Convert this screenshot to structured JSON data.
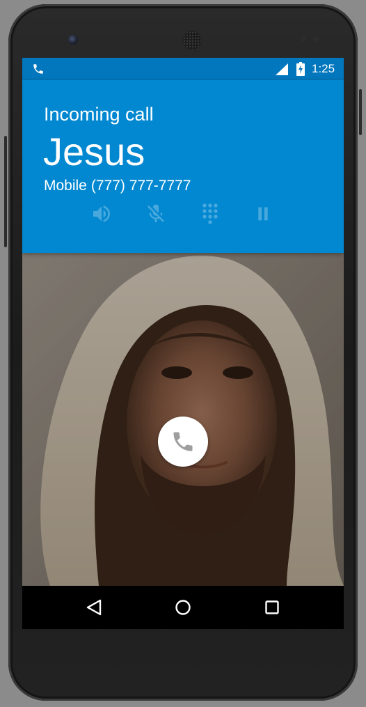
{
  "status_bar": {
    "time": "1:25",
    "icons": [
      "phone-icon",
      "signal-icon",
      "battery-charging-icon"
    ],
    "color": "#0277bd"
  },
  "call": {
    "state": "Incoming call",
    "caller_name": "Jesus",
    "number_type": "Mobile",
    "number": "(777) 777-7777",
    "header_color": "#0288d1"
  },
  "actions": [
    {
      "name": "speaker",
      "icon": "speaker-icon"
    },
    {
      "name": "mute",
      "icon": "mic-off-icon"
    },
    {
      "name": "dialpad",
      "icon": "dialpad-icon"
    },
    {
      "name": "hold",
      "icon": "pause-icon"
    }
  ],
  "answer_button": {
    "icon": "phone-icon",
    "color": "#ffffff"
  },
  "nav_bar": {
    "buttons": [
      "back-icon",
      "home-icon",
      "recent-apps-icon"
    ]
  }
}
